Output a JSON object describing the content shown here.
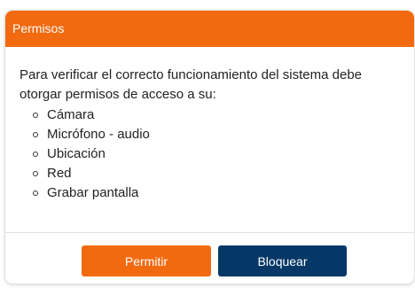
{
  "dialog": {
    "title": "Permisos",
    "message": "Para verificar el correcto funcionamiento del sistema debe otorgar permisos de acceso a su:",
    "permissions": [
      "Cámara",
      "Micrófono - audio",
      "Ubicación",
      "Red",
      "Grabar pantalla"
    ],
    "allow_label": "Permitir",
    "block_label": "Bloquear"
  },
  "colors": {
    "header": "#f26a0f",
    "allow_button": "#f26a0f",
    "block_button": "#063867"
  }
}
